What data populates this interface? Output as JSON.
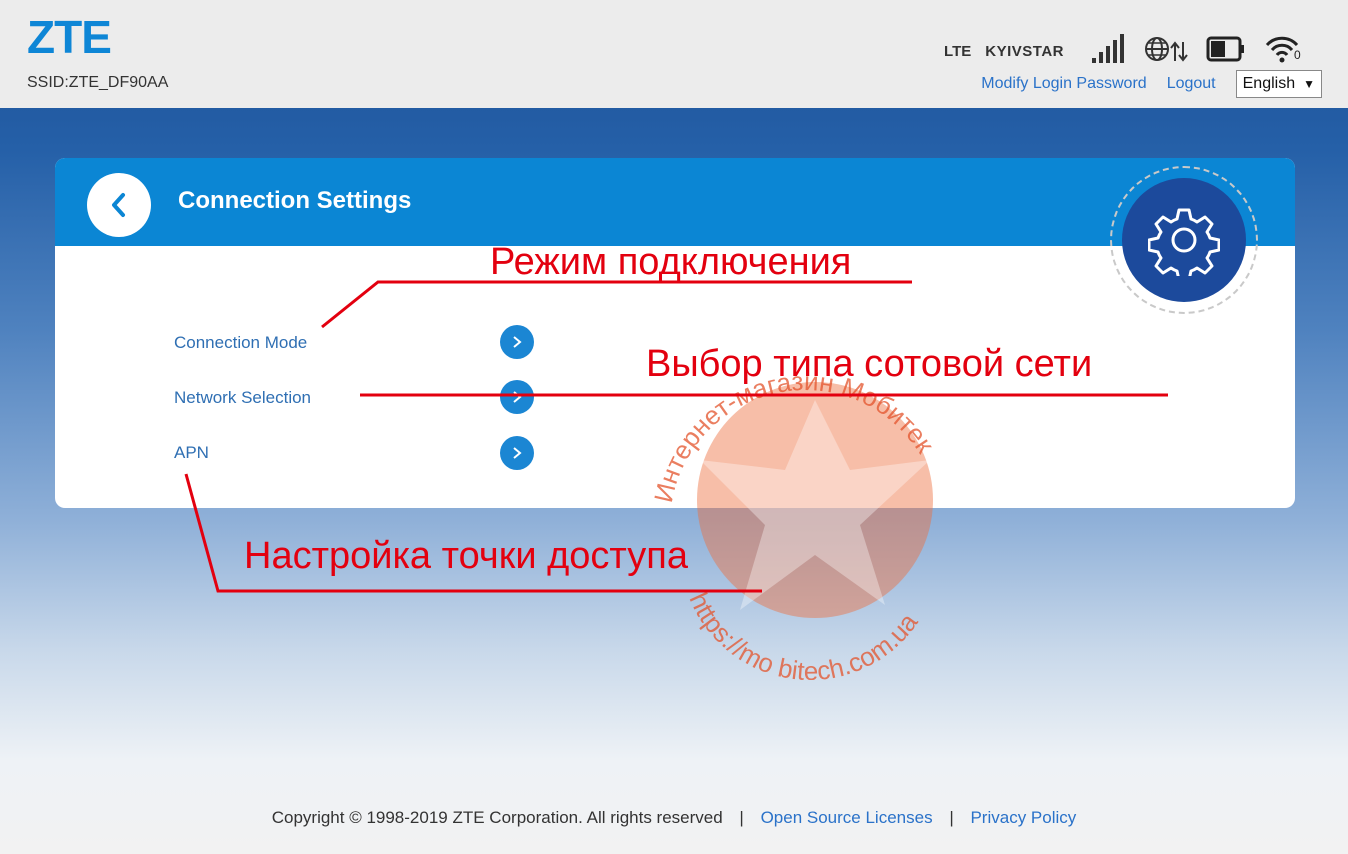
{
  "header": {
    "logo": "ZTE",
    "ssid": "SSID:ZTE_DF90AA",
    "network_type": "LTE",
    "carrier": "KYIVSTAR",
    "icons": [
      "signal-strength-icon",
      "internet-connected-icon",
      "battery-icon",
      "wifi-icon"
    ],
    "wifi_clients": "0",
    "modify_password_label": "Modify Login Password",
    "logout_label": "Logout",
    "language_value": "English"
  },
  "panel": {
    "title": "Connection Settings",
    "items": [
      {
        "label": "Connection Mode"
      },
      {
        "label": "Network Selection"
      },
      {
        "label": "APN"
      }
    ]
  },
  "annotations": {
    "connection_mode": "Режим подключения",
    "network_selection": "Выбор типа сотовой сети",
    "apn": "Настройка точки доступа"
  },
  "watermark": {
    "text_top": "Интернет-магазин Мобитек",
    "text_bottom": "https://mo bitech.com.ua"
  },
  "footer": {
    "copyright": "Copyright © 1998-2019 ZTE Corporation. All rights reserved",
    "open_source_label": "Open Source Licenses",
    "privacy_label": "Privacy Policy"
  },
  "colors": {
    "accent": "#0b86d4",
    "gear_bg": "#1c4a9c",
    "annotation": "#e3000f",
    "link": "#2a72c9"
  }
}
